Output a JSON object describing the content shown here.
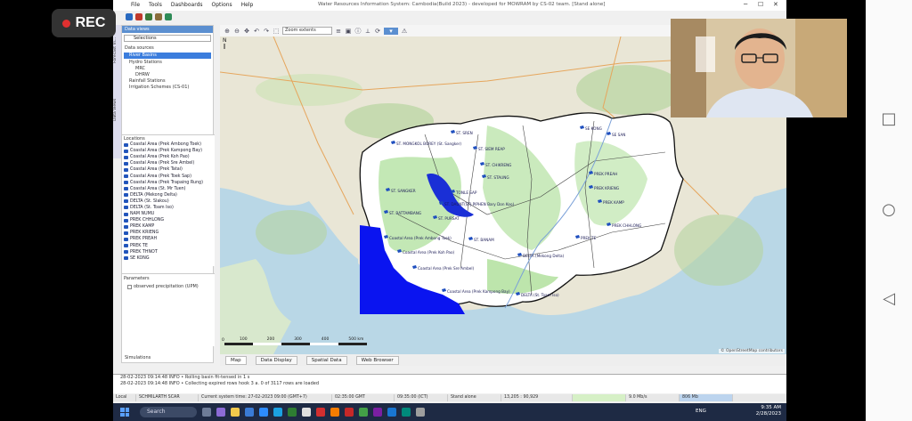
{
  "recording": {
    "label": "REC"
  },
  "app": {
    "window_title": "Water Resources Information System: Cambodia(Build 2023) - developed for MOWRAM by CS-02 team. [Stand alone]",
    "menu": [
      "File",
      "Tools",
      "Dashboards",
      "Options",
      "Help"
    ],
    "zoom_select": "Zoom extents"
  },
  "side_tabs": [
    "Forecast Vi...",
    "Data Views"
  ],
  "left_panel": {
    "header": "Data views",
    "selections_label": "Selections",
    "data_sources_label": "Data sources",
    "tree": [
      {
        "label": "River Basins",
        "selected": true
      },
      {
        "label": "Hydro Stations"
      },
      {
        "label": "MRC"
      },
      {
        "label": "DHRW"
      },
      {
        "label": "Rainfall Stations"
      },
      {
        "label": "Irrigation Schemes (CS-01)"
      }
    ],
    "locations_label": "Locations",
    "locations": [
      "Coastal Area (Prek Ambong Toek)",
      "Coastal Area (Prek Kampong Bay)",
      "Coastal Area (Prek Koh Pao)",
      "Coastal Area (Prek Sre Ambel)",
      "Coastal Area (Prek Tatai)",
      "Coastal Area (Prek Toek Sap)",
      "Coastal Area (Prek Trapaing Rung)",
      "Coastal Area (St. Mr Tuen)",
      "DELTA (Mekong Delta)",
      "DELTA (St. Slakou)",
      "DELTA (St. Toam Iso)",
      "NAM NUMU",
      "PREK CHHLONG",
      "PREK KAMP",
      "PREK KRIENG",
      "PREK PREAH",
      "PREK TE",
      "PREK THNOT",
      "SE KONG"
    ],
    "parameters_label": "Parameters",
    "parameters": [
      "observed precipitation (UPM)"
    ],
    "simulations_label": "Simulations"
  },
  "map": {
    "attribution": "© OpenStreetMap contributors",
    "scale_labels": [
      "0",
      "100",
      "200",
      "300",
      "400",
      "500 km"
    ],
    "basin_labels": [
      "ST. MONGKOL BOREY (St. Sangker)",
      "ST. SREN",
      "ST. SIEM REAP",
      "ST. CHIKRENG",
      "ST. SANGKER",
      "ST. STAUNG",
      "TONLE SAP",
      "ST. DAUNT(STJ PIPHEN Bary Don Koo)",
      "ST. PURSAT",
      "ST. BANAM",
      "SE KONG",
      "SE SAN",
      "PREK PREAH",
      "PREK KRIENG",
      "PREK KAMP",
      "PREK CHHLONG",
      "Coastal Area (Prek Ambong Toek)",
      "Coastal Area (Prek Koh Pao)",
      "Coastal Area (Prek Sre Ambel)",
      "Coastal Area (Prek Kampong Bay)",
      "DELTA (Mekong Delta)",
      "DELTA (St. Toam Iso)",
      "PREK TE",
      "ST. BATTAMBANG"
    ]
  },
  "map_tabs": [
    "Map",
    "Data Display",
    "Spatial Data",
    "Web Browser"
  ],
  "log": [
    "28-02-2023 09:14:48 INFO • Rolling basin fit-tensed in 1 s",
    "28-02-2023 09:14:48 INFO • Collecting expired rows hook 3 a. 0 of 3117 rows are loaded"
  ],
  "status": {
    "cells": [
      "Local",
      "SCHMILARTH SCAR",
      "Current system time: 27-02-2023 09:00 (GMT+7)",
      "02:35:00 GMT",
      "09:35:00 (ICT)",
      "Stand alone",
      "13,205 : 90,929",
      "",
      "9.0 Mb/s",
      "806 Mb"
    ]
  },
  "taskbar": {
    "search_label": "Search",
    "language": "ENG",
    "time": "9:35 AM",
    "date": "2/28/2023"
  },
  "colors": {
    "accent": "#3b7ddd",
    "basin_highlight": "#0a14f0",
    "lake": "#1a2fd6"
  }
}
